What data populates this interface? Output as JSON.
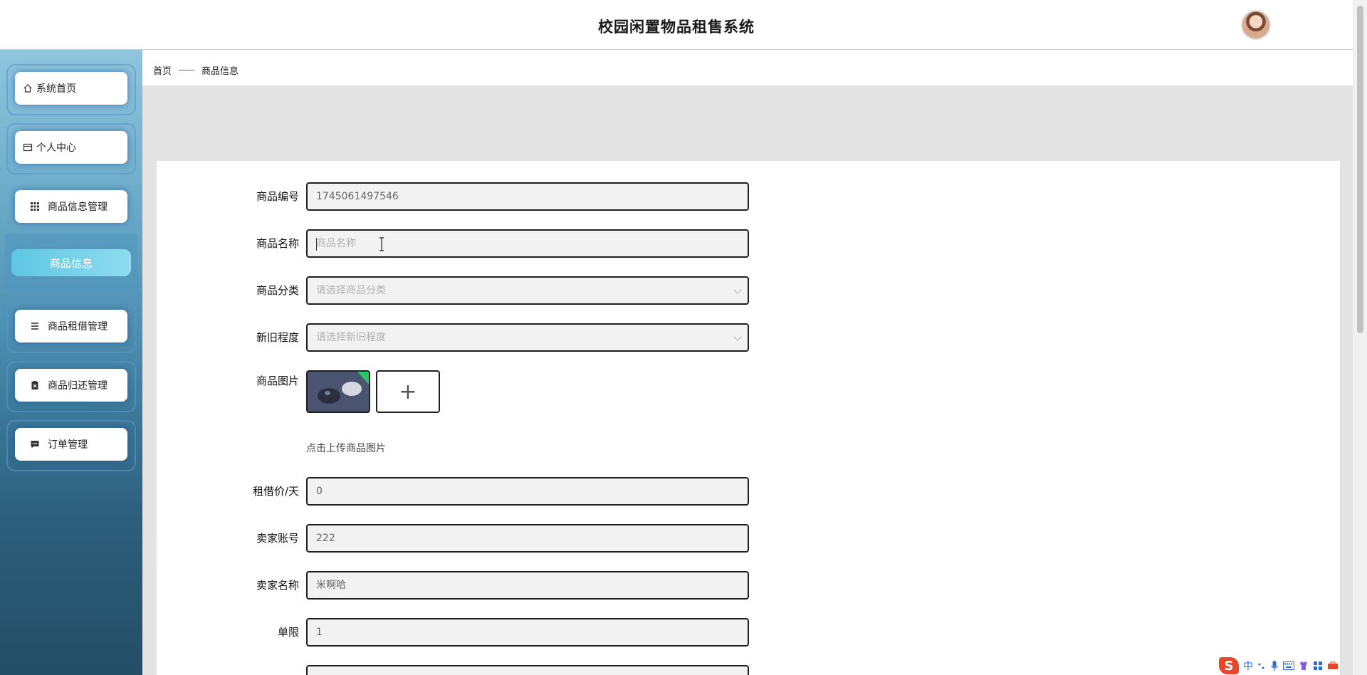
{
  "app": {
    "title": "校园闲置物品租售系统"
  },
  "sidebar": {
    "items": [
      {
        "label": "系统首页",
        "icon": "home-icon"
      },
      {
        "label": "个人中心",
        "icon": "card-icon"
      },
      {
        "label": "商品信息管理",
        "icon": "grid-icon"
      },
      {
        "label": "商品租借管理",
        "icon": "list-icon"
      },
      {
        "label": "商品归还管理",
        "icon": "clipboard-icon"
      },
      {
        "label": "订单管理",
        "icon": "message-icon"
      }
    ],
    "sub_items": [
      {
        "label": "商品信息"
      }
    ]
  },
  "breadcrumb": {
    "home": "首页",
    "current": "商品信息"
  },
  "form": {
    "fields": [
      {
        "label": "商品编号",
        "value": "1745061497546",
        "placeholder": ""
      },
      {
        "label": "商品名称",
        "value": "",
        "placeholder": "商品名称"
      },
      {
        "label": "商品分类",
        "value": "",
        "placeholder": "请选择商品分类"
      },
      {
        "label": "新旧程度",
        "value": "",
        "placeholder": "请选择新旧程度"
      },
      {
        "label": "商品图片"
      },
      {
        "label": "租借价/天",
        "value": "0"
      },
      {
        "label": "卖家账号",
        "value": "222"
      },
      {
        "label": "卖家名称",
        "value": "米啊哈"
      },
      {
        "label": "单限",
        "value": "1"
      }
    ],
    "upload_hint": "点击上传商品图片",
    "upload_add_symbol": "+"
  },
  "ime": {
    "logo": "S",
    "mode": "中"
  }
}
